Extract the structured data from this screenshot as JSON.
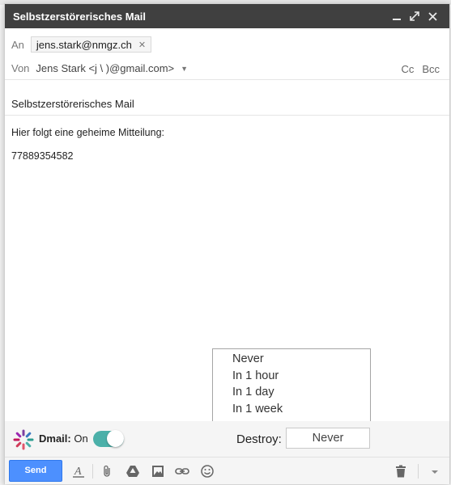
{
  "window": {
    "title": "Selbstzerstörerisches Mail"
  },
  "compose": {
    "to_label": "An",
    "to_recipient": "jens.stark@nmgz.ch",
    "from_label": "Von",
    "from_value": "Jens Stark <j     \\     )@gmail.com>",
    "cc_label": "Cc",
    "bcc_label": "Bcc",
    "subject": "Selbstzerstörerisches Mail",
    "body_lines": [
      "Hier folgt eine geheime Mitteilung:",
      "77889354582"
    ]
  },
  "dmail": {
    "brand": "Dmail:",
    "state": "On",
    "toggle_on": true,
    "destroy_label": "Destroy:",
    "destroy_selected": "Never",
    "destroy_options": [
      "Never",
      "In 1 hour",
      "In 1 day",
      "In 1 week"
    ]
  },
  "toolbar": {
    "send_label": "Send"
  },
  "colors": {
    "titlebar": "#404040",
    "send_button": "#4d90fe",
    "toggle": "#4bb0a9"
  },
  "icons": {
    "minimize": "minimize-icon",
    "popout": "expand-icon",
    "close": "close-icon",
    "format": "text-format-icon",
    "attach": "paperclip-icon",
    "drive": "drive-icon",
    "photo": "photo-icon",
    "link": "link-icon",
    "emoji": "smiley-icon",
    "discard": "trash-icon",
    "more": "chevron-down-icon"
  }
}
